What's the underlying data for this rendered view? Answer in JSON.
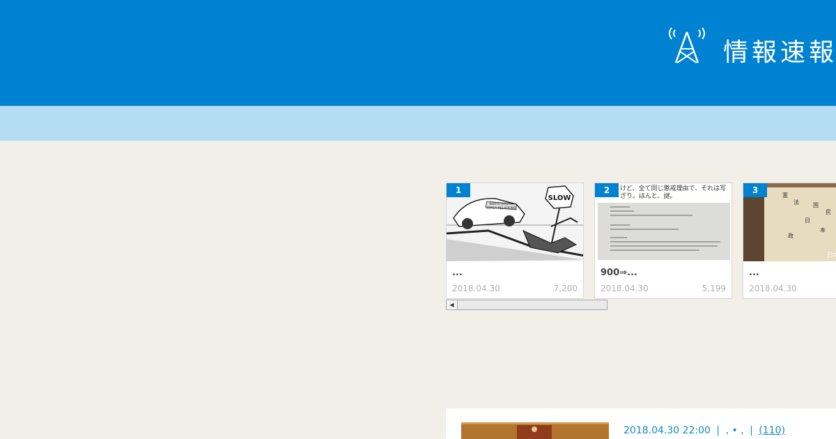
{
  "header": {
    "logo_text": "情報速報",
    "logo_icon": "broadcast-antenna-icon",
    "background_color": "#0082d2",
    "subbar_color": "#b4dcf2"
  },
  "ranking": {
    "items": [
      {
        "rank": "1",
        "title": "...",
        "date": "2018.04.30",
        "count": "7,200",
        "thumb_caption": [
          "NORTH-SOUTH",
          "KOREA RELATIONS"
        ],
        "thumb_sign": "SLOW"
      },
      {
        "rank": "2",
        "title": "900⇒...",
        "date": "2018.04.30",
        "count": "5,199",
        "thumb_caption": [
          "けど、全て同じ懲戒理由で、それは写",
          "ざり。ほんと、謎。"
        ]
      },
      {
        "rank": "3",
        "title": "...",
        "date": "2018.04.30",
        "count": "",
        "thumb_caption": [
          "日本国憲法"
        ]
      }
    ]
  },
  "article": {
    "datetime": "2018.04.30 22:00",
    "separator": "|",
    "tags": ", • ,",
    "comments": "(110)"
  },
  "colors": {
    "accent": "#0082d2",
    "page_bg": "#f2efe8",
    "link": "#0e8bbf"
  }
}
